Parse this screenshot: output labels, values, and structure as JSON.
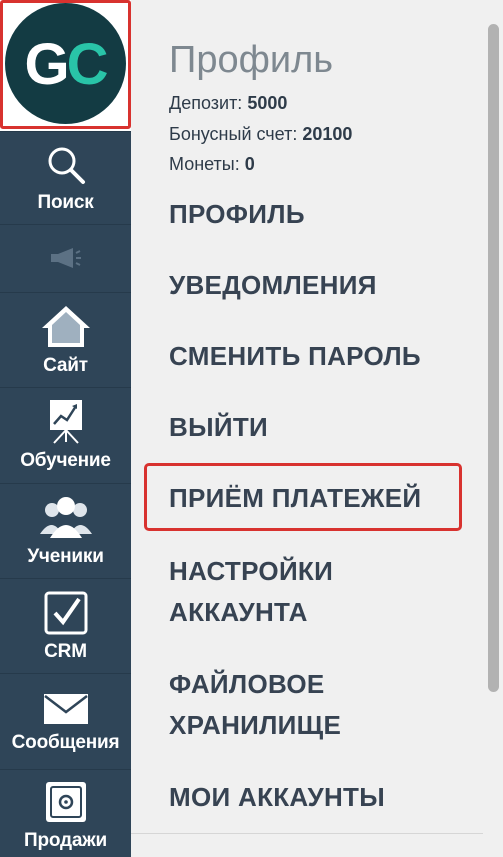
{
  "logo": {
    "text": "GC",
    "bg_color": "#133b43",
    "accent_color": "#29c4a8"
  },
  "sidebar": {
    "items": [
      {
        "label": "Поиск",
        "icon": "search-icon"
      },
      {
        "label": "",
        "icon": "megaphone-icon"
      },
      {
        "label": "Сайт",
        "icon": "home-icon"
      },
      {
        "label": "Обучение",
        "icon": "presentation-chart-icon"
      },
      {
        "label": "Ученики",
        "icon": "users-icon"
      },
      {
        "label": "CRM",
        "icon": "checkbox-icon"
      },
      {
        "label": "Сообщения",
        "icon": "envelope-icon"
      },
      {
        "label": "Продажи",
        "icon": "safe-icon"
      }
    ]
  },
  "profile": {
    "title": "Профиль",
    "deposit_label": "Депозит: ",
    "deposit_value": "5000",
    "bonus_label": "Бонусный счет: ",
    "bonus_value": "20100",
    "coins_label": "Монеты: ",
    "coins_value": "0"
  },
  "menu": {
    "items": [
      {
        "label": "ПРОФИЛЬ"
      },
      {
        "label": "УВЕДОМЛЕНИЯ"
      },
      {
        "label": "СМЕНИТЬ ПАРОЛЬ"
      },
      {
        "label": "ВЫЙТИ"
      },
      {
        "label": "ПРИЁМ ПЛАТЕЖЕЙ"
      },
      {
        "label": "НАСТРОЙКИ АККАУНТА"
      },
      {
        "label": "ФАЙЛОВОЕ ХРАНИЛИЩЕ"
      },
      {
        "label": "МОИ АККАУНТЫ"
      }
    ]
  },
  "colors": {
    "sidebar_bg": "#2f4558",
    "highlight_red": "#d8322f",
    "menu_text": "#374352",
    "title_gray": "#7e8890"
  }
}
